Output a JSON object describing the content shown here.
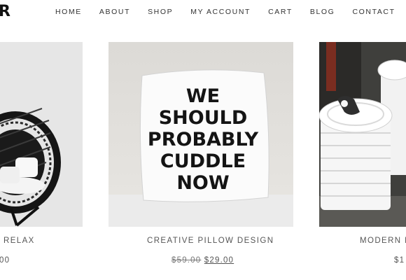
{
  "header": {
    "logo_text": "R",
    "nav": [
      "HOME",
      "ABOUT",
      "SHOP",
      "MY ACCOUNT",
      "CART",
      "BLOG",
      "CONTACT"
    ]
  },
  "products": [
    {
      "title": "RELAX",
      "price": "00"
    },
    {
      "title": "CREATIVE PILLOW DESIGN",
      "old_price": "$59.00",
      "new_price": "$29.00",
      "pillow_text": [
        "WE",
        "SHOULD",
        "PROBABLY",
        "CUDDLE",
        "NOW"
      ]
    },
    {
      "title": "MODERN FA",
      "price": "$1"
    }
  ]
}
